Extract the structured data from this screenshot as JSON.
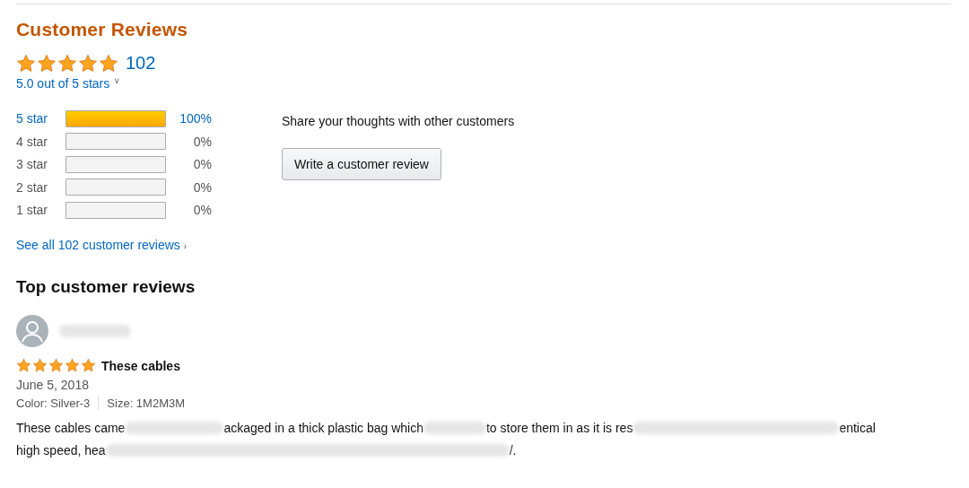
{
  "heading": "Customer Reviews",
  "summary": {
    "stars": 5,
    "count": "102",
    "average": "5.0 out of 5 stars",
    "caret": "˅"
  },
  "histogram": [
    {
      "label": "5 star",
      "level": 1,
      "percent": "100%"
    },
    {
      "label": "4 star",
      "level": 0,
      "percent": "0%"
    },
    {
      "label": "3 star",
      "level": 0,
      "percent": "0%"
    },
    {
      "label": "2 star",
      "level": 0,
      "percent": "0%"
    },
    {
      "label": "1 star",
      "level": 0,
      "percent": "0%"
    }
  ],
  "see_all": {
    "text": "See all 102 customer reviews",
    "chevron": "›"
  },
  "share": {
    "prompt": "Share your thoughts with other customers",
    "button": "Write a customer review"
  },
  "top_reviews": {
    "title": "Top customer reviews",
    "reviews": [
      {
        "reviewer": {
          "kind": "redacted"
        },
        "stars": 5,
        "title": "These cables",
        "date": "June 5, 2018",
        "attributes": [
          "Color: Silver-3",
          "Size: 1M2M3M"
        ],
        "lines": [
          [
            {
              "kind": "text",
              "text": "These cables came"
            },
            {
              "kind": "redacted"
            },
            {
              "kind": "text",
              "text": "ackaged in a thick plastic bag which"
            },
            {
              "kind": "redacted"
            },
            {
              "kind": "text",
              "text": "to store them in as it is res"
            },
            {
              "kind": "redacted"
            },
            {
              "kind": "text",
              "text": "entical"
            }
          ],
          [
            {
              "kind": "text",
              "text": "high speed, hea"
            },
            {
              "kind": "redacted"
            },
            {
              "kind": "text",
              "text": "/."
            }
          ]
        ]
      }
    ]
  }
}
